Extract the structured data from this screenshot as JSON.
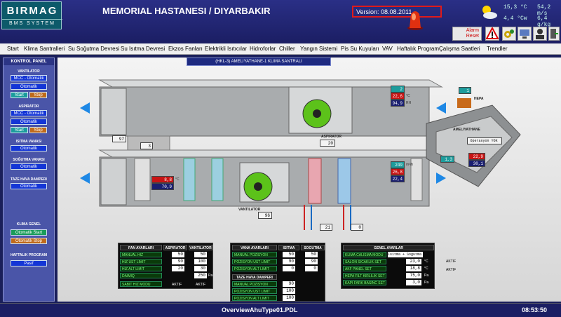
{
  "header": {
    "logo_brand": "BIRMAG",
    "logo_sub": "BMS SYSTEM",
    "title": "MEMORIAL HASTANESI / DIYARBAKIR",
    "version": "Version: 08.08.2011",
    "alarm_reset": "Alarm Reset",
    "weather": {
      "t1": "15,3 °C",
      "t2": "54,2 m/s",
      "t3": "4,4 °Cw",
      "t4": "6,4 g/kg"
    }
  },
  "menu": [
    "Start",
    "Klima Santralleri",
    "Su Soğutma Devresi",
    "Su Isıtma Devresi",
    "Ekzos Fanları",
    "Elektrikli Isıtıcılar",
    "Hidroforlar",
    "Chiller",
    "Yangın Sistemi",
    "Pis Su Kuyuları",
    "VAV",
    "Haftalık Program",
    "Çalışma Saatleri",
    "Trendler"
  ],
  "control_panel": {
    "title": "KONTROL PANEL",
    "vantilator": "VANTILATOR",
    "aspirator": "ASPIRATOR",
    "mcc": "MCC - Otomatik",
    "otomatik": "Otomatik",
    "start": "Start",
    "stop": "Stop",
    "isitma": "ISITMA VANASI",
    "sogutma": "SOĞUTMA VANASI",
    "taze": "TAZE HAVA DAMPERI",
    "genel": "KLIMA GENEL",
    "genel_start": "Otomatik Start",
    "genel_stop": "Otomatik Stop",
    "haftalik": "HAFTALIK PROGRAM",
    "pasif": "Pasif"
  },
  "diagram": {
    "title": "(HKL-3) AMELIYATHANE-1 KLIMA SANTRALI",
    "aspirator_label": "ASPIRATOR",
    "vantilator_label": "VANTILATOR",
    "ameliyathane": "AMELIYATHANE",
    "operasyon": "Operasyon YOK",
    "hepa": "HEPA",
    "exhaust_pct": "20",
    "exhaust_damper": "97",
    "upper_press": "3",
    "supply_pct": "96",
    "heat_valve": "21",
    "cool_valve": "0",
    "fresh_temp": "8,8",
    "fresh_rh": "70,9",
    "return_press": "2",
    "return_temp": "22,6",
    "return_rh": "94,9",
    "supply_flow": "249",
    "supply_temp": "26,8",
    "supply_rh": "22,4",
    "room_press": "1",
    "room_in": "1,3",
    "room_temp": "22,9",
    "room_rh": "30,1",
    "lbl_pa": "Pa",
    "lbl_c": "°C",
    "lbl_rh": "RH",
    "lbl_pct": "%",
    "lbl_m3": "m³/h"
  },
  "fan_table": {
    "h1": "FAN AYARLARI",
    "h2": "ASPIRATOR",
    "h3": "VANTILATOR",
    "rows": [
      {
        "label": "MANUAL HIZ",
        "a": "50",
        "v": "50",
        "u": "%"
      },
      {
        "label": "HIZ UST LIMIT",
        "a": "90",
        "v": "100",
        "u": "%"
      },
      {
        "label": "HIZ ALT LIMIT",
        "a": "20",
        "v": "30",
        "u": "%"
      },
      {
        "label": "DAIMIQ",
        "a": "",
        "v": "250",
        "u": "Pa"
      },
      {
        "label": "SABIT HIZ MODU",
        "a": "AKTIF",
        "v": "AKTIF",
        "u": ""
      }
    ]
  },
  "valve_table": {
    "h1": "VANA AYARLARI",
    "h2": "ISITMA",
    "h3": "SOGUTMA",
    "rows": [
      {
        "label": "MANUAL POZISYON",
        "a": "50",
        "v": "50",
        "u": "%"
      },
      {
        "label": "POZISYON UST LIMIT",
        "a": "90",
        "v": "90",
        "u": "%"
      },
      {
        "label": "POZISYON ALT LIMIT",
        "a": "0",
        "v": "0",
        "u": "%"
      }
    ],
    "h4": "TAZE HAVA DAMPERI",
    "rows2": [
      {
        "label": "MANUAL POZISYON",
        "v": "90",
        "u": "%"
      },
      {
        "label": "POZISYON UST LIMIT",
        "v": "100",
        "u": "%"
      },
      {
        "label": "POZISYON ALT LIMIT",
        "v": "100",
        "u": "%"
      }
    ]
  },
  "general_table": {
    "h1": "GENEL AYARLAR",
    "rows": [
      {
        "label": "KLIMA CALISMA MODU",
        "v": "Isitma + Sogutma",
        "u": ""
      },
      {
        "label": "SALON SICAKLIK SET",
        "v": "23,0",
        "u": "°C"
      },
      {
        "label": "AKF PANEL SET",
        "v": "18,8",
        "u": "°C"
      },
      {
        "label": "HEPA FILT KIRLILIK SET",
        "v": "75,0",
        "u": "Pa"
      },
      {
        "label": "KAPI FARK BASINC SET",
        "v": "3,0",
        "u": "Pa"
      }
    ],
    "aktif": "AKTIF"
  },
  "footer": {
    "file": "OverviewAhuType01.PDL",
    "clock": "08:53:50"
  }
}
